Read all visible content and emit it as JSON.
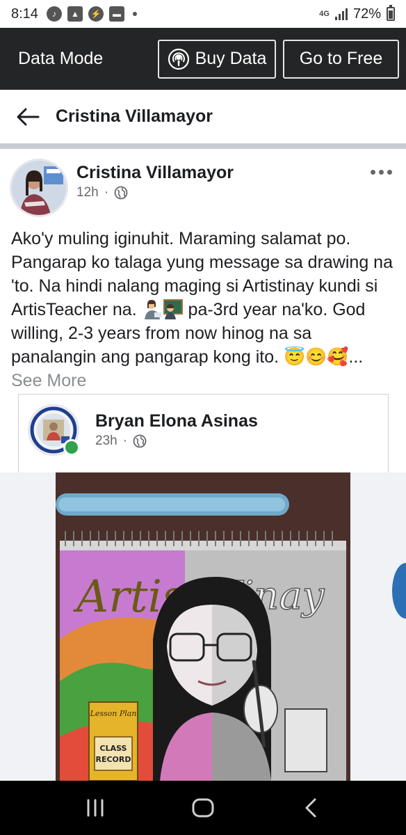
{
  "status_bar": {
    "time": "8:14",
    "network": "4G",
    "battery": "72%",
    "battery_level": 0.72,
    "notification_icons": [
      "tiktok-icon",
      "gallery-icon",
      "messenger-icon",
      "message-icon"
    ]
  },
  "data_mode": {
    "label": "Data Mode",
    "buy_data_label": "Buy Data",
    "go_free_label": "Go to Free"
  },
  "header": {
    "title": "Cristina Villamayor"
  },
  "post": {
    "author": "Cristina Villamayor",
    "time": "12h",
    "separator": "·",
    "text_line1": "Ako'y muling iginuhit. Maraming salamat po. Pangarap ko talaga yung message sa drawing na 'to. Na hindi nalang maging si Artistinay kundi si ArtisTeacher na. ",
    "text_line2": " pa-3rd year na'ko. God willing, 2-3 years from now hinog na sa panalangin ang  pangarap kong ito. ",
    "emojis_end": "😇😊🥰",
    "ellipsis": "... ",
    "see_more": "See More"
  },
  "shared_post": {
    "author": "Bryan Elona Asinas",
    "time": "23h",
    "separator": "·"
  },
  "drawing": {
    "title_text": "ArtisTinay",
    "book_label_top": "Lesson Plan",
    "book_label": "CLASS RECORD"
  },
  "colors": {
    "data_mode_bg": "#242526",
    "link_gray": "#8a8d91",
    "online_green": "#31a24c"
  }
}
